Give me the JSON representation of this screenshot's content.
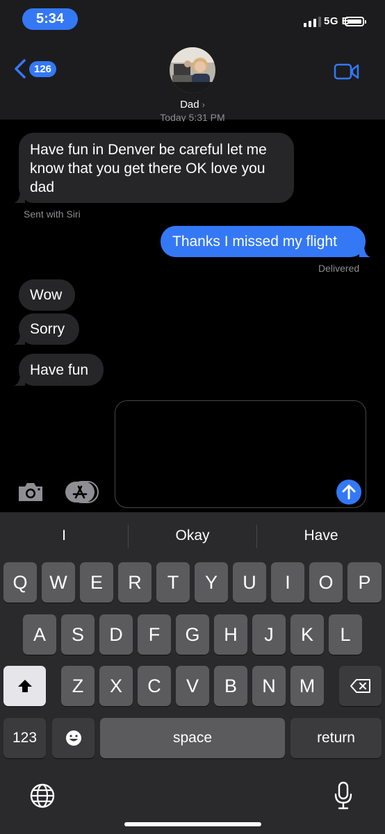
{
  "status_bar": {
    "time": "5:34",
    "network": "5G E"
  },
  "header": {
    "back_count": "126",
    "contact_name": "Dad",
    "timestamp": "Today 5:31 PM"
  },
  "messages": {
    "m1": "Have fun in Denver be careful let me know that you get there OK love you dad",
    "m1_note": "Sent with Siri",
    "m2": "Thanks I missed my flight",
    "m2_status": "Delivered",
    "m3": "Wow",
    "m4": "Sorry",
    "m5": "Have fun"
  },
  "compose": {
    "text": ""
  },
  "predictions": [
    "I",
    "Okay",
    "Have"
  ],
  "keyboard": {
    "row1": [
      "Q",
      "W",
      "E",
      "R",
      "T",
      "Y",
      "U",
      "I",
      "O",
      "P"
    ],
    "row2": [
      "A",
      "S",
      "D",
      "F",
      "G",
      "H",
      "J",
      "K",
      "L"
    ],
    "row3": [
      "Z",
      "X",
      "C",
      "V",
      "B",
      "N",
      "M"
    ],
    "numbers_label": "123",
    "space_label": "space",
    "return_label": "return"
  },
  "icons": {
    "back": "chevron-left-icon",
    "video": "video-camera-icon",
    "camera": "camera-icon",
    "apps": "app-store-icon",
    "send": "arrow-up-icon",
    "shift": "shift-icon",
    "delete": "delete-backspace-icon",
    "emoji": "emoji-icon",
    "globe": "globe-icon",
    "mic": "microphone-icon"
  },
  "colors": {
    "accent": "#3478f6",
    "incoming_bubble": "#262628",
    "keyboard_bg": "#2a2a2c",
    "key": "#5b5b5e"
  }
}
